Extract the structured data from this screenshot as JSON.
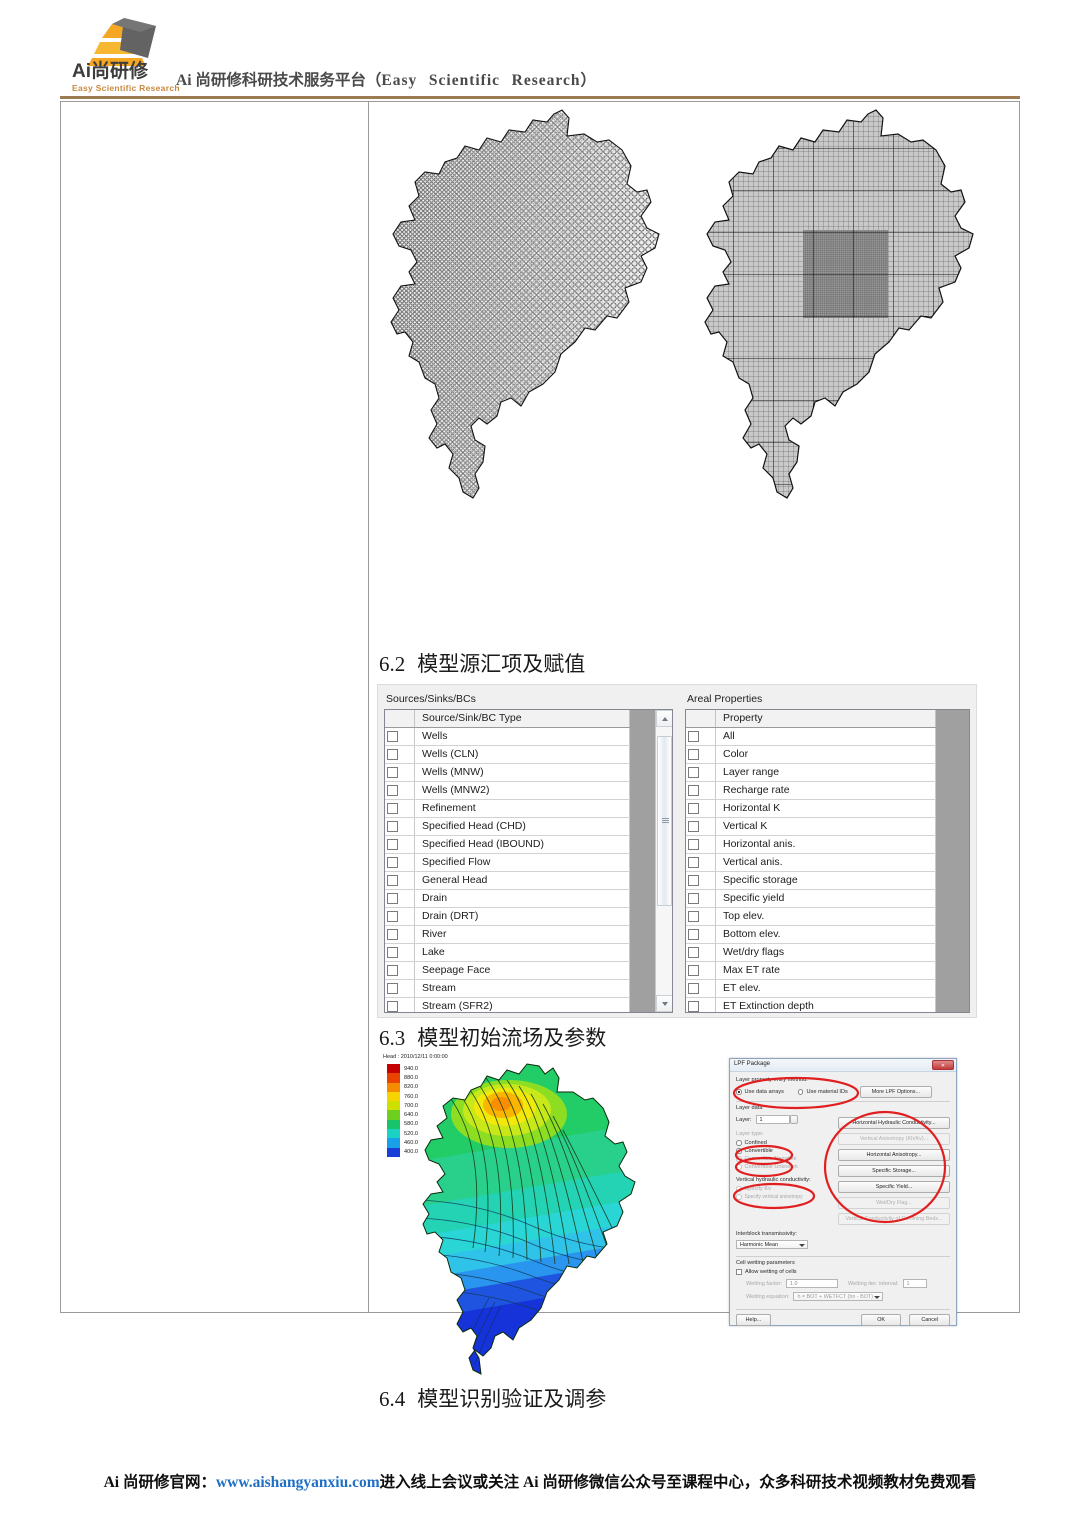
{
  "header": {
    "logo_cn": "Ai尚研修",
    "logo_en": "Easy Scientific Research",
    "tagline_cn": "Ai 尚研修科研技术服务平台（",
    "tagline_en_1": "Easy",
    "tagline_en_2": "Scientific",
    "tagline_en_3": "Research",
    "tagline_close": "）",
    "rule_color": "#9c7b52"
  },
  "sections": {
    "s62": {
      "num": "6.2",
      "title": "模型源汇项及赋值"
    },
    "s63": {
      "num": "6.3",
      "title": "模型初始流场及参数"
    },
    "s64": {
      "num": "6.4",
      "title": "模型识别验证及调参"
    }
  },
  "gms_panel": {
    "sources": {
      "group_title": "Sources/Sinks/BCs",
      "column_header": "Source/Sink/BC Type",
      "rows": [
        "Wells",
        "Wells (CLN)",
        "Wells (MNW)",
        "Wells (MNW2)",
        "Refinement",
        "Specified Head (CHD)",
        "Specified Head (IBOUND)",
        "Specified Flow",
        "General Head",
        "Drain",
        "Drain (DRT)",
        "River",
        "Lake",
        "Seepage Face",
        "Stream",
        "Stream (SFR2)"
      ],
      "scrollbar": {
        "up_arrow": "▲",
        "down_arrow": "▼"
      }
    },
    "areal": {
      "group_title": "Areal Properties",
      "column_header": "Property",
      "rows": [
        "All",
        "Color",
        "Layer range",
        "Recharge rate",
        "Horizontal K",
        "Vertical K",
        "Horizontal anis.",
        "Vertical anis.",
        "Specific storage",
        "Specific yield",
        "Top elev.",
        "Bottom elev.",
        "Wet/dry flags",
        "Max ET rate",
        "ET elev.",
        "ET Extinction depth"
      ]
    }
  },
  "head_map": {
    "legend_title": "Head : 2010/12/11 0:00:00",
    "legend_values": [
      "940.0",
      "880.0",
      "820.0",
      "760.0",
      "700.0",
      "640.0",
      "580.0",
      "520.0",
      "460.0",
      "400.0"
    ],
    "legend_colors": [
      "#c40000",
      "#e84400",
      "#f58c00",
      "#f5d400",
      "#cde000",
      "#6fcf1e",
      "#18c46a",
      "#1ad2c4",
      "#18a0e8",
      "#1a3fd8"
    ]
  },
  "lpf_dialog": {
    "title": "LPF Package",
    "close_label": "✕",
    "entry_method_label": "Layer property entry method:",
    "opt_data_arrays": "Use data arrays",
    "opt_material_ids": "Use material IDs",
    "more_options_btn": "More LPF Options...",
    "layer_data_label": "Layer data",
    "layer_label": "Layer:",
    "layer_value": "1",
    "layer_type_label": "Layer type:",
    "opt_confined": "Confined",
    "opt_convertible": "Convertible",
    "opt_convertible_negative": "Convertible Negative",
    "opt_convertible_unknown": "Convertible Unknown",
    "vert_hyd_label": "Vertical hydraulic conductivity:",
    "opt_specify_kv": "Specify Kv",
    "opt_specify_vani": "Specify vertical anisotropy",
    "interblock_label": "Interblock transmissivity:",
    "interblock_value": "Harmonic Mean",
    "cell_wetting_label": "Cell wetting parameters",
    "allow_wetting": "Allow wetting of cells",
    "wetting_factor_label": "Wetting factor:",
    "wetting_factor_value": "1.0",
    "wetting_iter_label": "Wetting iter. interval:",
    "wetting_iter_value": "1",
    "wetting_eq_label": "Wetting equation:",
    "wetting_eq_value": "h = BOT + WETFCT (hn - BOT)",
    "btn_horizontal_hyd": "Horizontal Hydraulic Conductivity...",
    "btn_vertical_anis": "Vertical Anisotropy (Kh/Kv)...",
    "btn_horizontal_anis": "Horizontal Anisotropy...",
    "btn_specific_storage": "Specific Storage...",
    "btn_specific_yield": "Specific Yield...",
    "btn_wet_dry": "Wet/Dry Flag...",
    "btn_vert_cond": "Vertical Conductivity of Confining Beds...",
    "btn_help": "Help...",
    "btn_ok": "OK",
    "btn_cancel": "Cancel",
    "annotation_color": "#e02020"
  },
  "footer": {
    "prefix": "Ai 尚研修官网：",
    "url": "www.aishangyanxiu.com",
    "suffix": "进入线上会议或关注 Ai 尚研修微信公众号至课程中心，众多科研技术视频教材免费观看",
    "url_color": "#1f6fc4"
  }
}
